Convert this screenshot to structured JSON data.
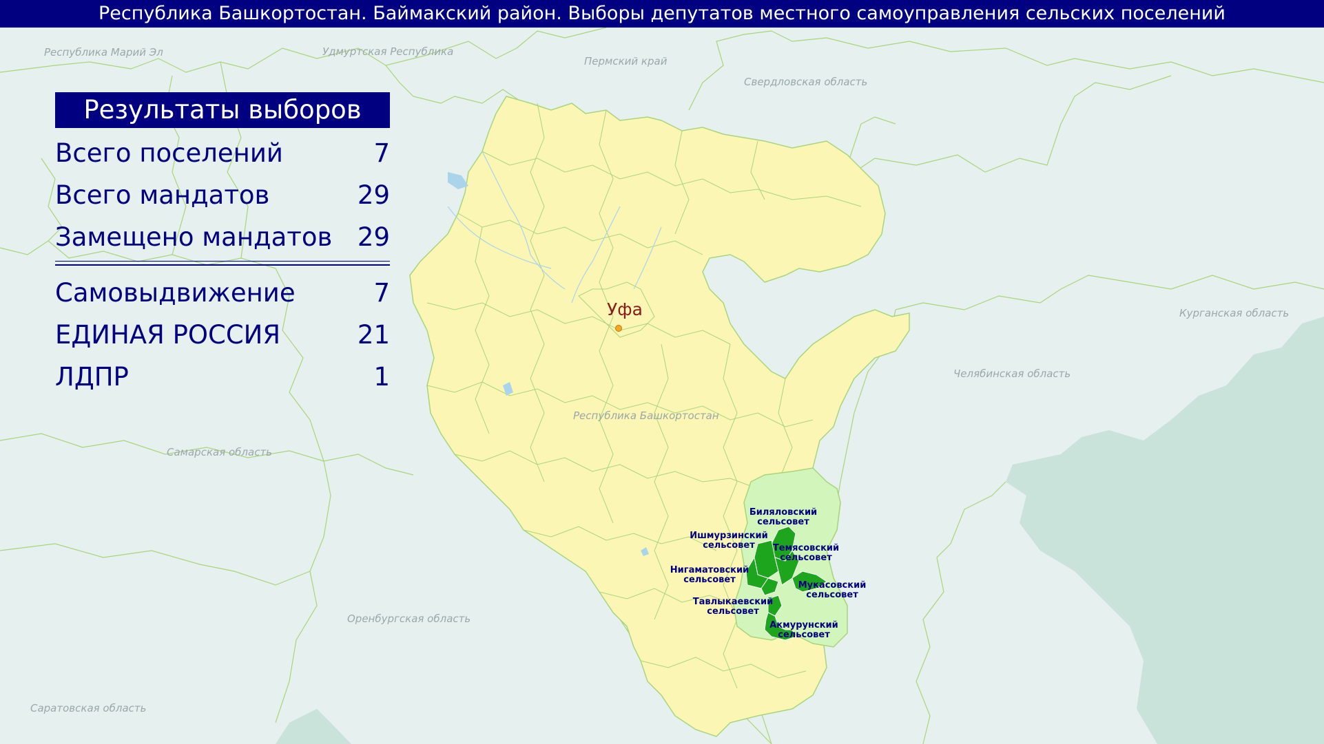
{
  "header": {
    "title": "Республика Башкортостан. Баймакский район. Выборы депутатов местного самоуправления сельских поселений"
  },
  "results": {
    "title": "Результаты выборов",
    "summary": [
      {
        "label": "Всего поселений",
        "value": "7"
      },
      {
        "label": "Всего мандатов",
        "value": "29"
      },
      {
        "label": "Замещено мандатов",
        "value": "29"
      }
    ],
    "parties": [
      {
        "label": "Самовыдвижение",
        "value": "7"
      },
      {
        "label": "ЕДИНАЯ РОССИЯ",
        "value": "21"
      },
      {
        "label": "ЛДПР",
        "value": "1"
      }
    ]
  },
  "map": {
    "regions": {
      "mari_el": "Республика Марий Эл",
      "udmurtia": "Удмуртская Республика",
      "perm": "Пермский край",
      "sverdlovsk": "Свердловская область",
      "kurgan": "Курганская область",
      "chelyabinsk": "Челябинская область",
      "bashkortostan": "Республика Башкортостан",
      "samara": "Самарская область",
      "orenburg": "Оренбургская область",
      "saratov": "Саратовская область"
    },
    "city": "Уфа",
    "municipalities": {
      "bilyalovsky": [
        "Биляловский",
        "сельсовет"
      ],
      "ishmurzinsky": [
        "Ишмурзинский",
        "сельсовет"
      ],
      "temyasovsky": [
        "Темясовский",
        "сельсовет"
      ],
      "nigamatovsky": [
        "Нигаматовский",
        "сельсовет"
      ],
      "mukasovsky": [
        "Мукасовский",
        "сельсовет"
      ],
      "tavlykaevsky": [
        "Тавлыкаевский",
        "сельсовет"
      ],
      "akmurunsky": [
        "Акмурунский",
        "сельсовет"
      ]
    },
    "colors": {
      "background": "#e6f0ef",
      "bashkortostan_fill": "#fbf6b4",
      "district_fill": "#d2f5bc",
      "elected_fill": "#1ea51e",
      "kazakhstan_fill": "#c9e3db",
      "border": "#a8d57a",
      "header": "#000080"
    }
  }
}
